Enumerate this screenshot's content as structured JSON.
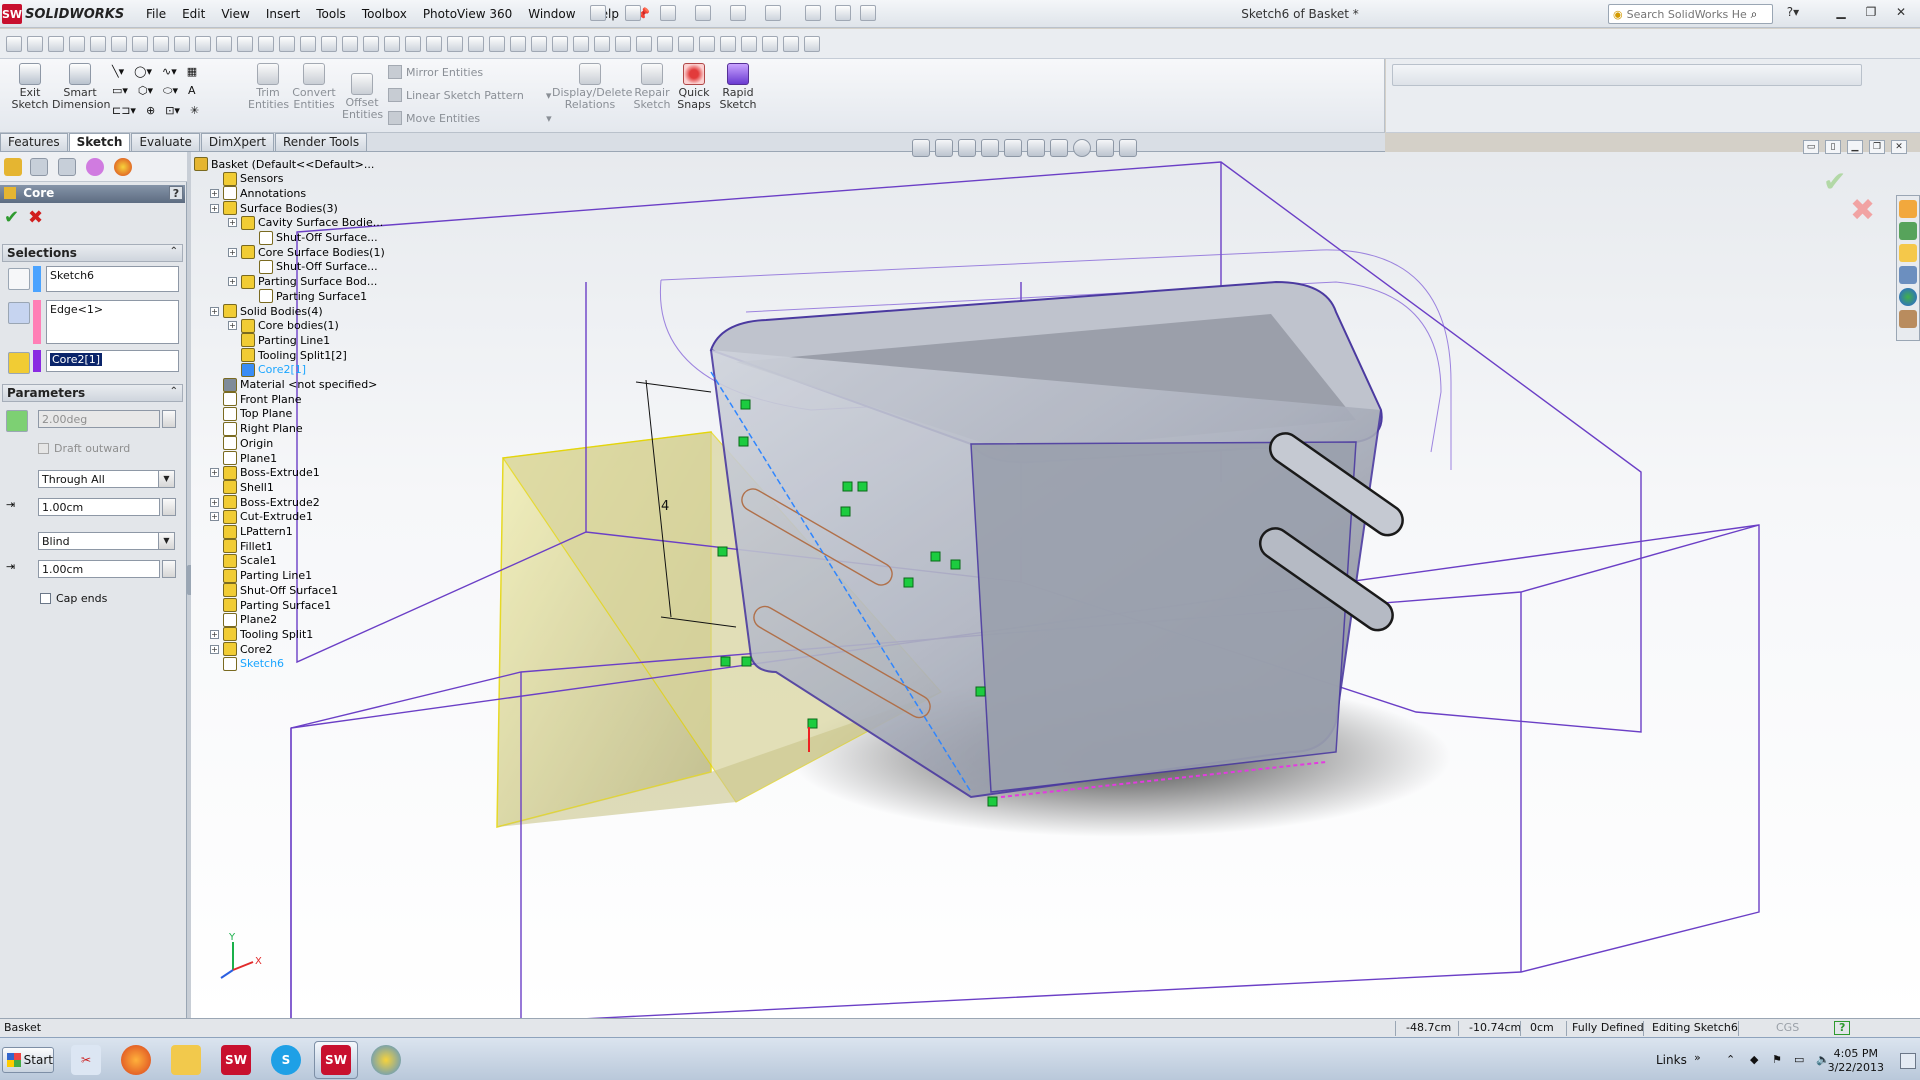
{
  "app": {
    "logo_text": "SOLIDWORKS",
    "logo_mark": "SW",
    "document_title": "Sketch6 of Basket *",
    "search_placeholder": "Search SolidWorks Help"
  },
  "menu": [
    "File",
    "Edit",
    "View",
    "Insert",
    "Tools",
    "Toolbox",
    "PhotoView 360",
    "Window",
    "Help"
  ],
  "command_manager": {
    "exit_sketch": [
      "Exit",
      "Sketch"
    ],
    "smart_dimension": [
      "Smart",
      "Dimension"
    ],
    "trim_entities": [
      "Trim",
      "Entities"
    ],
    "convert_entities": [
      "Convert",
      "Entities"
    ],
    "offset_entities": [
      "Offset",
      "Entities"
    ],
    "mirror_entities": "Mirror Entities",
    "linear_sketch_pattern": "Linear Sketch Pattern",
    "move_entities": "Move Entities",
    "display_delete_relations": [
      "Display/Delete",
      "Relations"
    ],
    "repair_sketch": [
      "Repair",
      "Sketch"
    ],
    "quick_snaps": [
      "Quick",
      "Snaps"
    ],
    "rapid_sketch": [
      "Rapid",
      "Sketch"
    ]
  },
  "tabs": [
    {
      "label": "Features",
      "active": false
    },
    {
      "label": "Sketch",
      "active": true
    },
    {
      "label": "Evaluate",
      "active": false
    },
    {
      "label": "DimXpert",
      "active": false
    },
    {
      "label": "Render Tools",
      "active": false
    }
  ],
  "property_manager": {
    "title": "Core",
    "help": "?",
    "selections_label": "Selections",
    "sketch_value": "Sketch6",
    "edge_value": "Edge<1>",
    "core_value": "Core2[1]",
    "parameters_label": "Parameters",
    "draft_angle": "2.00deg",
    "draft_outward_label": "Draft outward",
    "end_condition_1": "Through All",
    "depth_1": "1.00cm",
    "end_condition_2": "Blind",
    "depth_2": "1.00cm",
    "cap_ends_label": "Cap ends",
    "colors": {
      "sketch": "#4aa3ff",
      "edge": "#ff7fb6",
      "core": "#8a2be2"
    }
  },
  "feature_tree": [
    {
      "label": "Basket  (Default<<Default>...",
      "indent": 0,
      "icon": "part-icon"
    },
    {
      "label": "Sensors",
      "indent": 1,
      "icon": "sensor-icon"
    },
    {
      "label": "Annotations",
      "indent": 1,
      "icon": "annotation-icon",
      "expand": true
    },
    {
      "label": "Surface Bodies(3)",
      "indent": 1,
      "icon": "surface-bodies-icon",
      "expand": true
    },
    {
      "label": "Cavity Surface Bodie...",
      "indent": 2,
      "icon": "folder-icon",
      "expand": true
    },
    {
      "label": "Shut-Off Surface...",
      "indent": 3,
      "icon": "surface-icon"
    },
    {
      "label": "Core Surface Bodies(1)",
      "indent": 2,
      "icon": "folder-icon",
      "expand": true
    },
    {
      "label": "Shut-Off Surface...",
      "indent": 3,
      "icon": "surface-icon"
    },
    {
      "label": "Parting Surface Bod...",
      "indent": 2,
      "icon": "folder-icon",
      "expand": true
    },
    {
      "label": "Parting Surface1",
      "indent": 3,
      "icon": "surface-icon"
    },
    {
      "label": "Solid Bodies(4)",
      "indent": 1,
      "icon": "solid-bodies-icon",
      "expand": true
    },
    {
      "label": "Core bodies(1)",
      "indent": 2,
      "icon": "folder-icon",
      "expand": true
    },
    {
      "label": "Parting Line1",
      "indent": 2,
      "icon": "body-icon"
    },
    {
      "label": "Tooling Split1[2]",
      "indent": 2,
      "icon": "body-icon"
    },
    {
      "label": "Core2[1]",
      "indent": 2,
      "icon": "body-blue-icon",
      "highlight": true
    },
    {
      "label": "Material <not specified>",
      "indent": 1,
      "icon": "material-icon"
    },
    {
      "label": "Front Plane",
      "indent": 1,
      "icon": "plane-icon"
    },
    {
      "label": "Top Plane",
      "indent": 1,
      "icon": "plane-icon"
    },
    {
      "label": "Right Plane",
      "indent": 1,
      "icon": "plane-icon"
    },
    {
      "label": "Origin",
      "indent": 1,
      "icon": "origin-icon"
    },
    {
      "label": "Plane1",
      "indent": 1,
      "icon": "plane-icon"
    },
    {
      "label": "Boss-Extrude1",
      "indent": 1,
      "icon": "extrude-icon",
      "expand": true
    },
    {
      "label": "Shell1",
      "indent": 1,
      "icon": "shell-icon"
    },
    {
      "label": "Boss-Extrude2",
      "indent": 1,
      "icon": "extrude-icon",
      "expand": true
    },
    {
      "label": "Cut-Extrude1",
      "indent": 1,
      "icon": "cut-icon",
      "expand": true
    },
    {
      "label": "LPattern1",
      "indent": 1,
      "icon": "pattern-icon"
    },
    {
      "label": "Fillet1",
      "indent": 1,
      "icon": "fillet-icon"
    },
    {
      "label": "Scale1",
      "indent": 1,
      "icon": "scale-icon"
    },
    {
      "label": "Parting Line1",
      "indent": 1,
      "icon": "parting-line-icon"
    },
    {
      "label": "Shut-Off Surface1",
      "indent": 1,
      "icon": "shutoff-icon"
    },
    {
      "label": "Parting Surface1",
      "indent": 1,
      "icon": "parting-surface-icon"
    },
    {
      "label": "Plane2",
      "indent": 1,
      "icon": "plane-icon"
    },
    {
      "label": "Tooling Split1",
      "indent": 1,
      "icon": "tooling-split-icon",
      "expand": true
    },
    {
      "label": "Core2",
      "indent": 1,
      "icon": "core-icon",
      "expand": true
    },
    {
      "label": "Sketch6",
      "indent": 1,
      "icon": "sketch-icon",
      "highlight": true
    }
  ],
  "statusbar": {
    "doc": "Basket",
    "x": "-48.7cm",
    "y": "-10.74cm",
    "z": "0cm",
    "state": "Fully Defined",
    "mode": "Editing Sketch6",
    "units": "CGS",
    "help": "?"
  },
  "taskbar": {
    "start": "Start",
    "apps": [
      "snipping-tool",
      "firefox",
      "explorer",
      "solidworks",
      "skype",
      "solidworks-active",
      "paint"
    ],
    "links": "Links",
    "time": "4:05 PM",
    "date": "3/22/2013"
  },
  "triad": {
    "y": "Y",
    "x": "X"
  }
}
